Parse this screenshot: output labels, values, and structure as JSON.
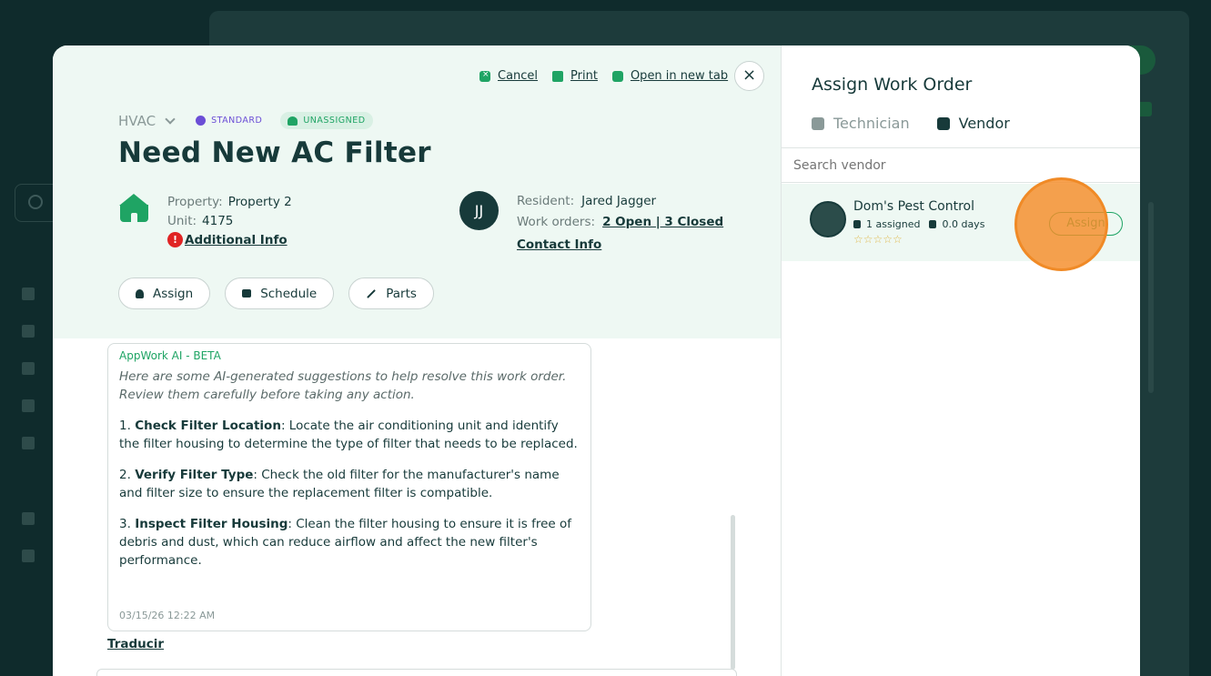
{
  "modal": {
    "top_actions": {
      "cancel": "Cancel",
      "print": "Print",
      "open_new_tab": "Open in new tab"
    },
    "close_label": "×",
    "category": "HVAC",
    "badges": {
      "priority": "STANDARD",
      "assignment": "UNASSIGNED"
    },
    "title": "Need New AC Filter",
    "property": {
      "property_label": "Property:",
      "property_value": "Property 2",
      "unit_label": "Unit:",
      "unit_value": "4175",
      "additional_info": "Additional Info",
      "warn_glyph": "!"
    },
    "resident": {
      "initials": "JJ",
      "resident_label": "Resident:",
      "resident_value": "Jared Jagger",
      "work_orders_label": "Work orders:",
      "work_orders_value": "2 Open | 3 Closed",
      "contact_info": "Contact Info"
    },
    "actions": {
      "assign": "Assign",
      "schedule": "Schedule",
      "parts": "Parts"
    },
    "ai": {
      "header": "AppWork AI - BETA",
      "intro": "Here are some AI-generated suggestions to help resolve this work order. Review them carefully before taking any action.",
      "items": [
        {
          "num": "1.",
          "bold": "Check Filter Location",
          "text": ": Locate the air conditioning unit and identify the filter housing to determine the type of filter that needs to be replaced."
        },
        {
          "num": "2.",
          "bold": "Verify Filter Type",
          "text": ": Check the old filter for the manufacturer's name and filter size to ensure the replacement filter is compatible."
        },
        {
          "num": "3.",
          "bold": "Inspect Filter Housing",
          "text": ": Clean the filter housing to ensure it is free of debris and dust, which can reduce airflow and affect the new filter's performance."
        }
      ],
      "timestamp": "03/15/26 12:22 AM",
      "translate": "Traducir"
    }
  },
  "assign_panel": {
    "title": "Assign Work Order",
    "tabs": {
      "technician": "Technician",
      "vendor": "Vendor"
    },
    "search_placeholder": "Search vendor",
    "vendor": {
      "name": "Dom's Pest Control",
      "assigned": "1 assigned",
      "days": "0.0 days",
      "stars": "☆☆☆☆☆",
      "assign": "Assign"
    }
  },
  "colors": {
    "accent": "#1fa464",
    "dark": "#173a3a",
    "header_bg": "#eef8f3",
    "priority": "#6b4ed6",
    "click_ring": "#f08a26"
  }
}
